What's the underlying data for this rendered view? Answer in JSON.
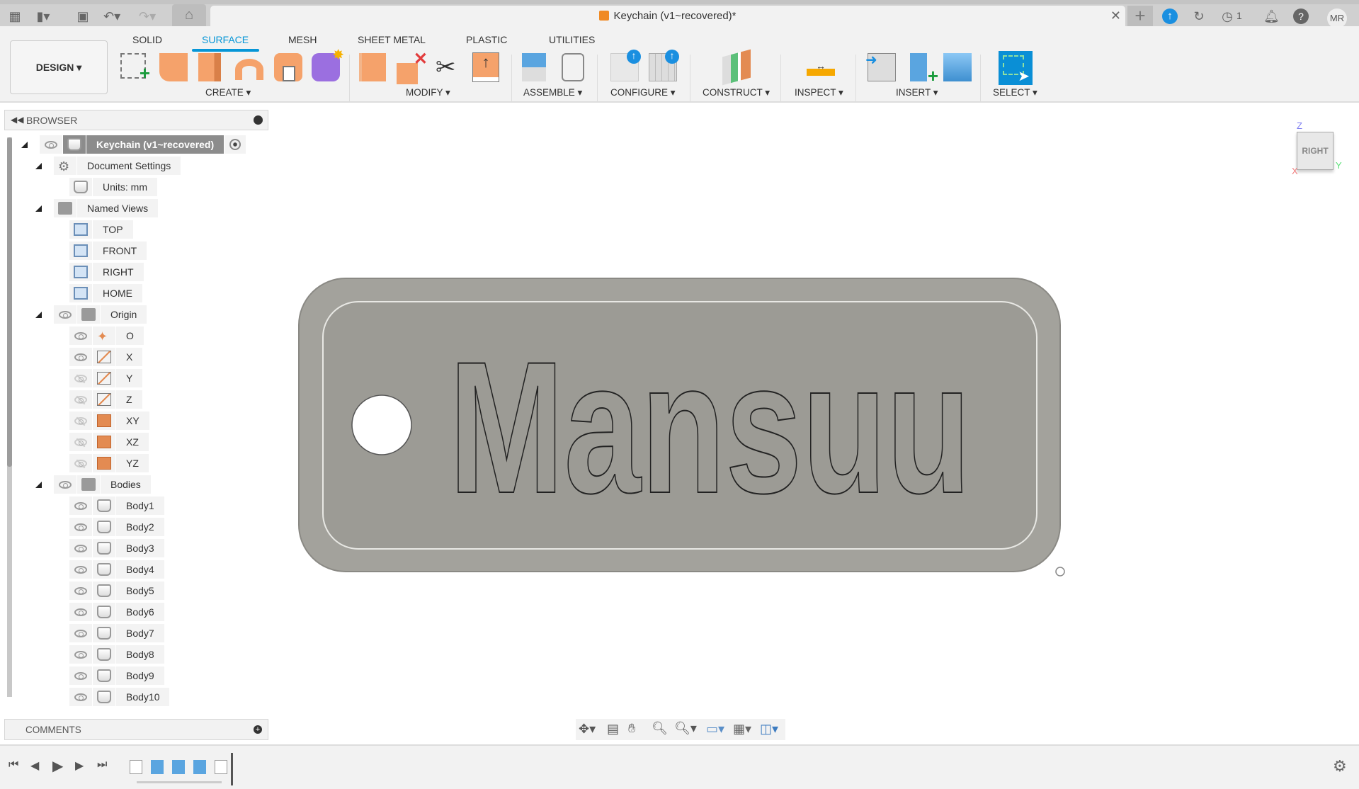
{
  "titlebar": {
    "document_title": "Keychain (v1~recovered)*",
    "user_initials": "MR",
    "job_count": "1"
  },
  "toolbar": {
    "workspace": "DESIGN ▾",
    "tabs": [
      "SOLID",
      "SURFACE",
      "MESH",
      "SHEET METAL",
      "PLASTIC",
      "UTILITIES"
    ],
    "active_tab": "SURFACE",
    "groups": [
      "CREATE ▾",
      "MODIFY ▾",
      "ASSEMBLE ▾",
      "CONFIGURE ▾",
      "CONSTRUCT ▾",
      "INSPECT ▾",
      "INSERT ▾",
      "SELECT ▾"
    ]
  },
  "browser": {
    "title": "BROWSER",
    "root": "Keychain (v1~recovered)",
    "document_settings": "Document Settings",
    "units": "Units: mm",
    "named_views": "Named Views",
    "views": [
      "TOP",
      "FRONT",
      "RIGHT",
      "HOME"
    ],
    "origin": "Origin",
    "origin_items": [
      {
        "label": "O",
        "visible": true
      },
      {
        "label": "X",
        "visible": true
      },
      {
        "label": "Y",
        "visible": false
      },
      {
        "label": "Z",
        "visible": false
      },
      {
        "label": "XY",
        "visible": false
      },
      {
        "label": "XZ",
        "visible": false
      },
      {
        "label": "YZ",
        "visible": false
      }
    ],
    "bodies": "Bodies",
    "body_items": [
      "Body1",
      "Body2",
      "Body3",
      "Body4",
      "Body5",
      "Body6",
      "Body7",
      "Body8",
      "Body9",
      "Body10"
    ]
  },
  "comments": {
    "title": "COMMENTS"
  },
  "viewport": {
    "model_text": "Mansuu",
    "viewcube_face": "RIGHT",
    "axes": {
      "z": "Z",
      "y": "Y",
      "x": "X"
    }
  },
  "colors": {
    "accent": "#0696d7",
    "model": "#a3a29c",
    "icon_orange": "#f5a26b"
  }
}
